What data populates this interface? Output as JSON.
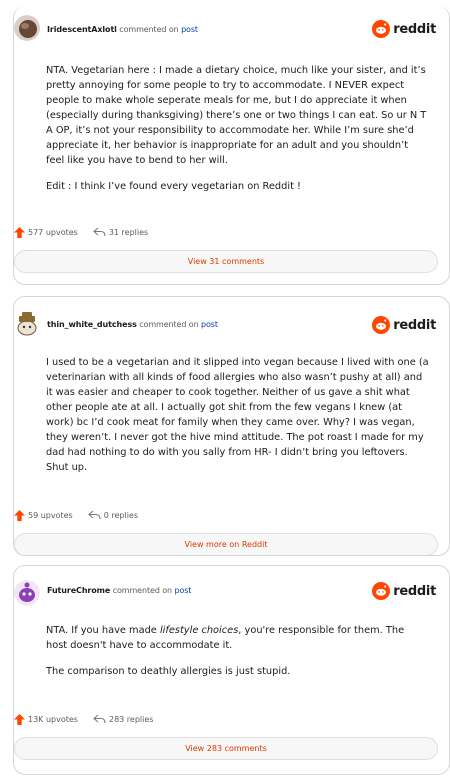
{
  "brand": {
    "name": "reddit",
    "color": "#ff4500"
  },
  "comments": [
    {
      "username": "IridescentAxlotl",
      "action": "commented on",
      "link": "post",
      "avatar": "brown-orb-avatar",
      "paragraphs": [
        "NTA. Vegetarian here : I made a dietary choice, much like your sister, and it’s pretty annoying for some people to try to accommodate. I NEVER expect people to make whole seperate meals for me, but I do appreciate it when (especially during thanksgiving) there’s one or two things I can eat. So ur N T A OP, it’s not your responsibility to accommodate her. While I’m sure she’d appreciate it, her behavior is inappropriate for an adult and you shouldn’t feel like you have to bend to her will.",
        "Edit : I think I’ve found every vegetarian on Reddit !"
      ],
      "upvotes": "577 upvotes",
      "replies": "31 replies",
      "button": "View 31 comments"
    },
    {
      "username": "thin_white_dutchess",
      "action": "commented on",
      "link": "post",
      "avatar": "snoo-hat-avatar",
      "paragraphs": [
        "I used to be a vegetarian and it slipped into vegan because I lived with one (a veterinarian with all kinds of food allergies who also wasn’t pushy at all) and it was easier and cheaper to cook together. Neither of us gave a shit what other people ate at all. I actually got shit from the few vegans I knew (at work) bc I’d cook meat for family when they came over. Why? I was vegan, they weren’t. I never got the hive mind attitude. The pot roast I made for my dad had nothing to do with you sally from HR- I didn’t bring you leftovers. Shut up."
      ],
      "upvotes": "59 upvotes",
      "replies": "0 replies",
      "button": "View more on Reddit"
    },
    {
      "username": "FutureChrome",
      "action": "commented on",
      "link": "post",
      "avatar": "purple-snoo-avatar",
      "paragraph_parts": [
        {
          "text": "NTA. If you have made ",
          "italic": false
        },
        {
          "text": "lifestyle choices",
          "italic": true
        },
        {
          "text": ", you're responsible for them. The host doesn't have to accommodate it.",
          "italic": false
        }
      ],
      "paragraphs": [
        "The comparison to deathly allergies is just stupid."
      ],
      "upvotes": "13K upvotes",
      "replies": "283 replies",
      "button": "View 283 comments"
    }
  ]
}
